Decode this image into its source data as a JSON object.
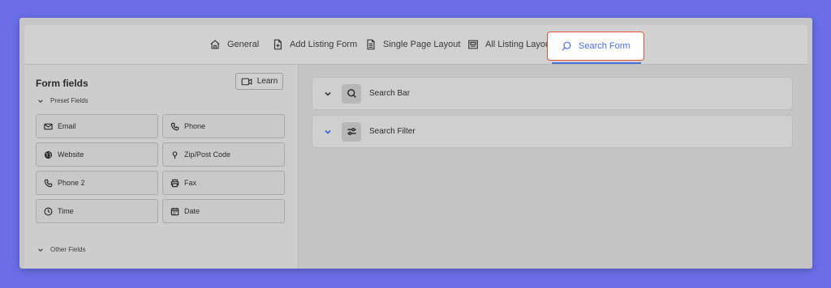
{
  "tabs": {
    "general": "General",
    "add_listing_form": "Add Listing Form",
    "single_page_layout": "Single Page Layout",
    "all_listing_layout": "All Listing Layout",
    "search_form": "Search Form"
  },
  "left_panel": {
    "title": "Form fields",
    "learn_button": "Learn",
    "preset_section": "Preset Fields",
    "other_section": "Other Fields",
    "fields": {
      "email": "Email",
      "phone": "Phone",
      "website": "Website",
      "zip": "Zip/Post Code",
      "phone2": "Phone 2",
      "fax": "Fax",
      "time": "Time",
      "date": "Date"
    }
  },
  "right_panel": {
    "search_bar": "Search Bar",
    "search_filter": "Search Filter"
  },
  "colors": {
    "background": "#6b6ee8",
    "active_tab_text": "#4e6ee0",
    "active_tab_border": "#e7513a"
  }
}
